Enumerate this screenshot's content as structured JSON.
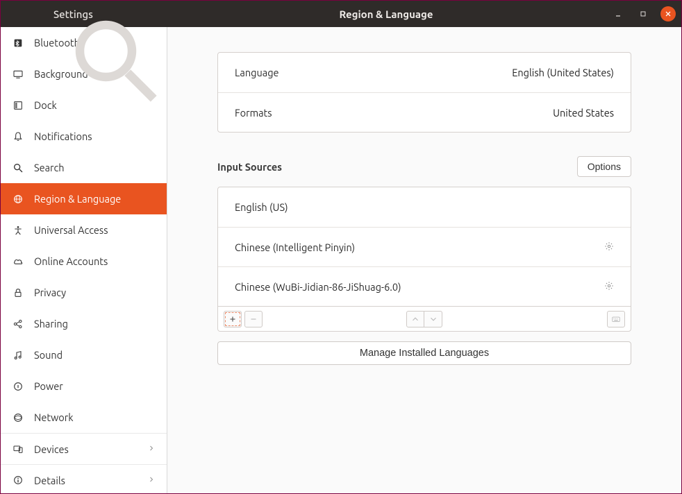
{
  "titlebar": {
    "sidebar_title": "Settings",
    "page_title": "Region & Language"
  },
  "sidebar": {
    "items": [
      {
        "id": "bluetooth",
        "label": "Bluetooth",
        "icon": "bluetooth-icon"
      },
      {
        "id": "background",
        "label": "Background",
        "icon": "display-icon"
      },
      {
        "id": "dock",
        "label": "Dock",
        "icon": "dock-icon"
      },
      {
        "id": "notifications",
        "label": "Notifications",
        "icon": "bell-icon"
      },
      {
        "id": "search",
        "label": "Search",
        "icon": "search-icon"
      },
      {
        "id": "region-language",
        "label": "Region & Language",
        "icon": "globe-icon",
        "active": true
      },
      {
        "id": "universal-access",
        "label": "Universal Access",
        "icon": "accessibility-icon"
      },
      {
        "id": "online-accounts",
        "label": "Online Accounts",
        "icon": "cloud-icon"
      },
      {
        "id": "privacy",
        "label": "Privacy",
        "icon": "lock-icon"
      },
      {
        "id": "sharing",
        "label": "Sharing",
        "icon": "share-icon"
      },
      {
        "id": "sound",
        "label": "Sound",
        "icon": "note-icon"
      },
      {
        "id": "power",
        "label": "Power",
        "icon": "power-icon"
      },
      {
        "id": "network",
        "label": "Network",
        "icon": "network-icon"
      },
      {
        "id": "devices",
        "label": "Devices",
        "icon": "devices-icon",
        "chevron": true,
        "sep": true
      },
      {
        "id": "details",
        "label": "Details",
        "icon": "info-icon",
        "chevron": true,
        "sep": true
      }
    ]
  },
  "main": {
    "language_label": "Language",
    "language_value": "English (United States)",
    "formats_label": "Formats",
    "formats_value": "United States",
    "input_sources_title": "Input Sources",
    "options_label": "Options",
    "sources": [
      {
        "label": "English (US)",
        "gear": false
      },
      {
        "label": "Chinese (Intelligent Pinyin)",
        "gear": true
      },
      {
        "label": "Chinese (WuBi-Jidian-86-JiShuag-6.0)",
        "gear": true
      }
    ],
    "manage_label": "Manage Installed Languages"
  }
}
